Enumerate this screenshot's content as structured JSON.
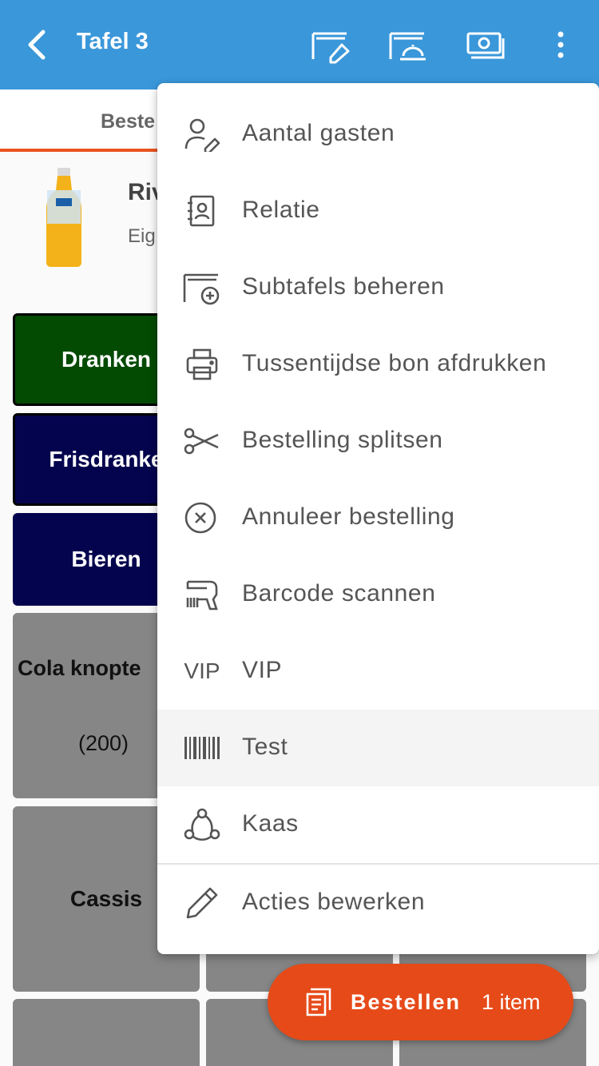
{
  "header": {
    "title": "Tafel 3",
    "actions": [
      "edit-table-icon",
      "table-service-icon",
      "payment-icon",
      "more-vert-icon"
    ]
  },
  "tabs": {
    "first_label": "Beste"
  },
  "product": {
    "name": "Riv",
    "subtitle": "Eig",
    "image": "rivella-bottle-icon"
  },
  "tiles": {
    "dranken": {
      "label": "Dranken",
      "color": "#034a03"
    },
    "frisdranken": {
      "label": "Frisdranke",
      "color": "#04044e"
    },
    "bieren": {
      "label": "Bieren",
      "color": "#04044e"
    },
    "cola": {
      "label": "Cola knopte",
      "price": "(200)"
    },
    "cassis": {
      "label": "Cassis"
    }
  },
  "menu": {
    "items": [
      {
        "label": "Aantal gasten",
        "icon": "person-edit-icon"
      },
      {
        "label": "Relatie",
        "icon": "contact-book-icon"
      },
      {
        "label": "Subtafels beheren",
        "icon": "table-add-icon"
      },
      {
        "label": "Tussentijdse bon afdrukken",
        "icon": "printer-icon"
      },
      {
        "label": "Bestelling splitsen",
        "icon": "scissors-icon"
      },
      {
        "label": "Annuleer bestelling",
        "icon": "cancel-circle-icon"
      },
      {
        "label": "Barcode scannen",
        "icon": "barcode-scanner-icon"
      },
      {
        "label": "VIP",
        "icon_text": "VIP"
      },
      {
        "label": "Test",
        "icon": "barcode-icon",
        "highlighted": true
      },
      {
        "label": "Kaas",
        "icon": "share-nodes-icon"
      },
      {
        "label": "Acties bewerken",
        "icon": "pencil-icon"
      }
    ]
  },
  "order_button": {
    "label": "Bestellen",
    "count": "1 item",
    "icon": "receipt-icon"
  },
  "colors": {
    "appbar": "#3a97da",
    "accent": "#e64a19",
    "tab_indicator": "#e95420"
  }
}
